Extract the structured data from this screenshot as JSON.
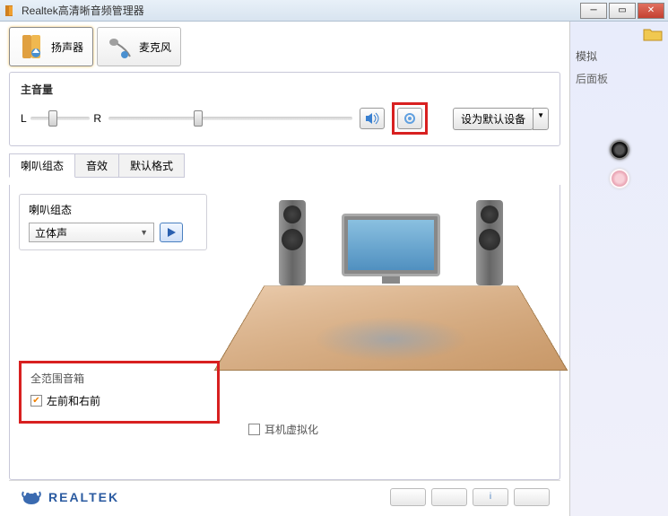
{
  "window": {
    "title": "Realtek高清晰音频管理器"
  },
  "device_tabs": {
    "speakers": "扬声器",
    "microphone": "麦克风"
  },
  "volume": {
    "label": "主音量",
    "left": "L",
    "right": "R"
  },
  "default_button": "设为默认设备",
  "config_tabs": {
    "speaker_config": "喇叭组态",
    "sound_effect": "音效",
    "default_format": "默认格式"
  },
  "speaker_config_group": {
    "label": "喇叭组态",
    "selected": "立体声"
  },
  "full_range": {
    "title": "全范围音箱",
    "option1": "左前和右前",
    "option1_checked": true
  },
  "headphone_virtualization": {
    "label": "耳机虚拟化",
    "checked": false
  },
  "side": {
    "title": "模拟",
    "sub": "后面板"
  },
  "brand": "REALTEK"
}
